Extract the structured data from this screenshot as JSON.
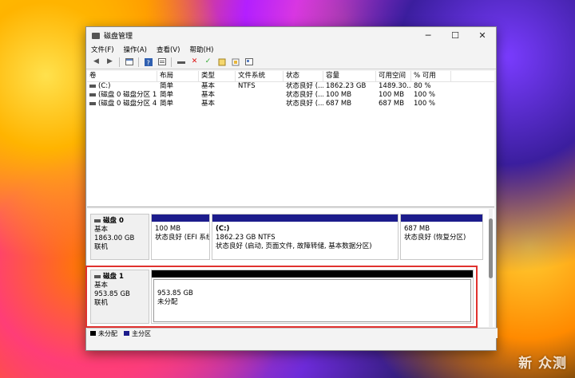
{
  "window": {
    "title": "磁盘管理"
  },
  "menu": [
    "文件(F)",
    "操作(A)",
    "查看(V)",
    "帮助(H)"
  ],
  "table": {
    "headers": [
      "卷",
      "布局",
      "类型",
      "文件系统",
      "状态",
      "容量",
      "可用空间",
      "% 可用"
    ],
    "rows": [
      [
        "(C:)",
        "简单",
        "基本",
        "NTFS",
        "状态良好 (...",
        "1862.23 GB",
        "1489.30...",
        "80 %"
      ],
      [
        "(磁盘 0 磁盘分区 1)",
        "简单",
        "基本",
        "",
        "状态良好 (...",
        "100 MB",
        "100 MB",
        "100 %"
      ],
      [
        "(磁盘 0 磁盘分区 4)",
        "简单",
        "基本",
        "",
        "状态良好 (...",
        "687 MB",
        "687 MB",
        "100 %"
      ]
    ]
  },
  "disk0": {
    "name": "磁盘 0",
    "type": "基本",
    "size": "1863.00 GB",
    "status": "联机",
    "p1": {
      "size": "100 MB",
      "status": "状态良好 (EFI 系统"
    },
    "p2": {
      "name": "(C:)",
      "size": "1862.23 GB NTFS",
      "status": "状态良好 (启动, 页面文件, 故障转储, 基本数据分区)"
    },
    "p3": {
      "size": "687 MB",
      "status": "状态良好 (恢复分区)"
    }
  },
  "disk1": {
    "name": "磁盘 1",
    "type": "基本",
    "size": "953.85 GB",
    "status": "联机",
    "p1": {
      "size": "953.85 GB",
      "status": "未分配"
    }
  },
  "legend": {
    "unallocated": "未分配",
    "primary": "主分区"
  },
  "watermark": "新 众测",
  "colors": {
    "primary_partition": "#1c1c8c",
    "unallocated": "#000000",
    "highlight": "#e0312e"
  }
}
